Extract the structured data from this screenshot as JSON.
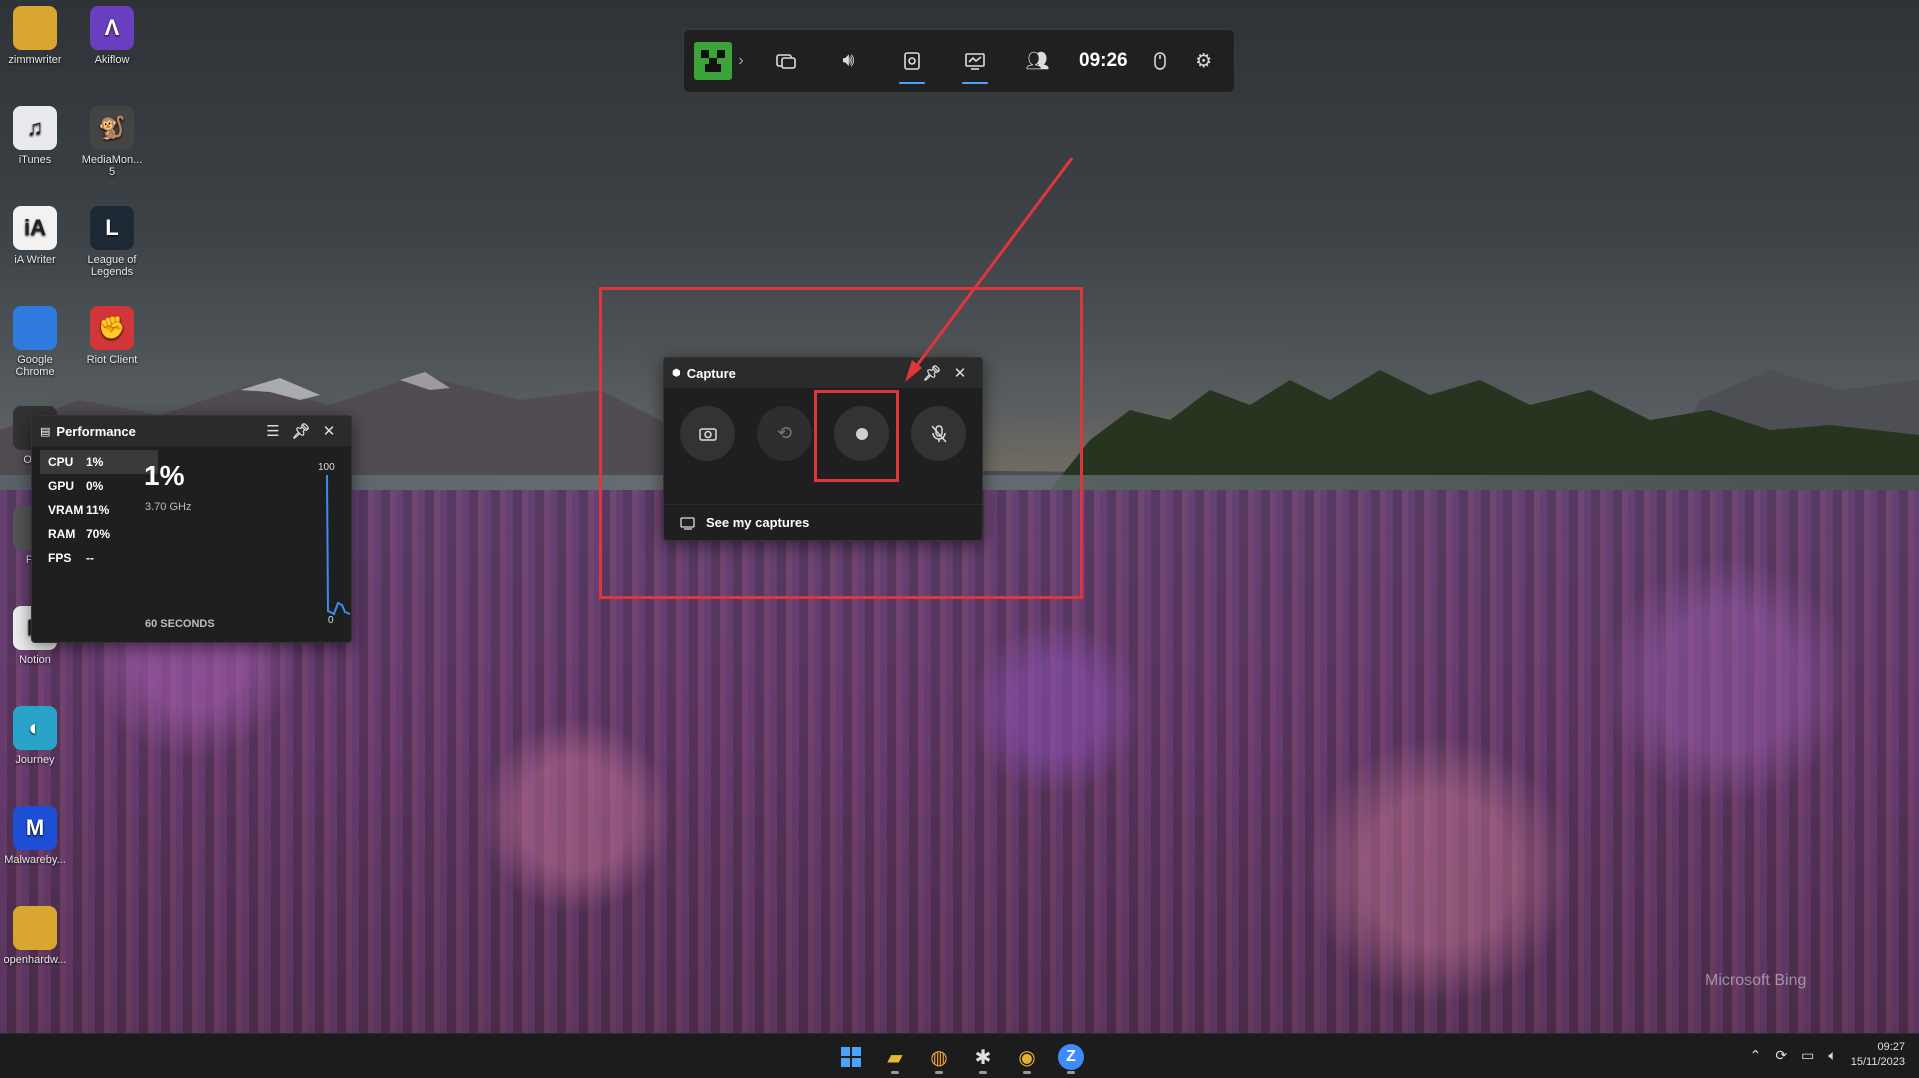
{
  "desktop": {
    "icons": [
      {
        "label": "zimmwriter",
        "icon": "folder-icon",
        "glyph": "",
        "color": "#d9a630"
      },
      {
        "label": "Akiflow",
        "icon": "akiflow-icon",
        "glyph": "Λ",
        "color": "#6a3fbf"
      },
      {
        "label": "iTunes",
        "icon": "itunes-icon",
        "glyph": "♫",
        "color": "#e9e9ef"
      },
      {
        "label": "MediaMon...\n5",
        "icon": "mediamonkey-icon",
        "glyph": "🐒",
        "color": "#444"
      },
      {
        "label": "iA Writer",
        "icon": "ia-writer-icon",
        "glyph": "iA",
        "color": "#f2f2f2"
      },
      {
        "label": "League of\nLegends",
        "icon": "league-of-legends-icon",
        "glyph": "L",
        "color": "#1d2a35"
      },
      {
        "label": "Google\nChrome",
        "icon": "chrome-icon",
        "glyph": "",
        "color": "#2f7be0"
      },
      {
        "label": "Riot Client",
        "icon": "riot-client-icon",
        "glyph": "✊",
        "color": "#d13639"
      },
      {
        "label": "OBS",
        "icon": "obs-icon",
        "glyph": "",
        "color": "#333"
      },
      {
        "label": "Pyx",
        "icon": "app-icon",
        "glyph": "",
        "color": "#555"
      },
      {
        "label": "Notion",
        "icon": "notion-icon",
        "glyph": "N",
        "color": "#eee"
      },
      {
        "label": "Journey",
        "icon": "journey-icon",
        "glyph": "◐",
        "color": "#2aa3c9"
      },
      {
        "label": "Malwareby...",
        "icon": "malwarebytes-icon",
        "glyph": "M",
        "color": "#1c4fd6"
      },
      {
        "label": "openhardw...",
        "icon": "folder-icon",
        "glyph": "",
        "color": "#d9a630"
      }
    ],
    "watermark": "Microsoft Bing"
  },
  "gamebar": {
    "time": "09:26",
    "buttons": [
      {
        "name": "widget-menu-icon",
        "glyph": "›"
      },
      {
        "name": "audio-widget-icon",
        "glyph": "🔊"
      },
      {
        "name": "capture-widget-icon",
        "glyph": "◉"
      },
      {
        "name": "performance-widget-icon",
        "glyph": "▤"
      },
      {
        "name": "xbox-social-icon",
        "glyph": "👥"
      }
    ],
    "mouse_icon": "mouse-icon",
    "settings_icon": "gear-icon"
  },
  "performance": {
    "title": "Performance",
    "metrics": [
      {
        "label": "CPU",
        "value": "1%"
      },
      {
        "label": "GPU",
        "value": "0%"
      },
      {
        "label": "VRAM",
        "value": "11%"
      },
      {
        "label": "RAM",
        "value": "70%"
      },
      {
        "label": "FPS",
        "value": "--"
      }
    ],
    "current_value": "1%",
    "current_sub": "3.70 GHz",
    "graph_max": "100",
    "graph_min": "0",
    "footer": "60 SECONDS"
  },
  "capture": {
    "title": "Capture",
    "buttons": [
      {
        "name": "screenshot-button",
        "glyph": "📷"
      },
      {
        "name": "record-last-30s-button",
        "glyph": "⟲"
      },
      {
        "name": "start-recording-button",
        "glyph": ""
      },
      {
        "name": "mic-toggle-button",
        "glyph": "🎙"
      }
    ],
    "see_captures": "See my captures"
  },
  "taskbar": {
    "apps": [
      {
        "name": "start-button",
        "glyph": "⊞",
        "color": "#4aa3ff"
      },
      {
        "name": "file-explorer-icon",
        "glyph": "📁",
        "color": "#e5b83a"
      },
      {
        "name": "app-launcher-icon",
        "glyph": "◍",
        "color": "#f1a33b"
      },
      {
        "name": "slack-icon",
        "glyph": "✱",
        "color": "#e0e0e0"
      },
      {
        "name": "chrome-taskbar-icon",
        "glyph": "◉",
        "color": "#e3b130"
      },
      {
        "name": "zoom-icon",
        "glyph": "Z",
        "color": "#3d8bff"
      }
    ],
    "clock_time": "09:27",
    "clock_date": "15/11/2023"
  },
  "colors": {
    "highlight": "#e0363b",
    "accent": "#4aa3ff"
  }
}
